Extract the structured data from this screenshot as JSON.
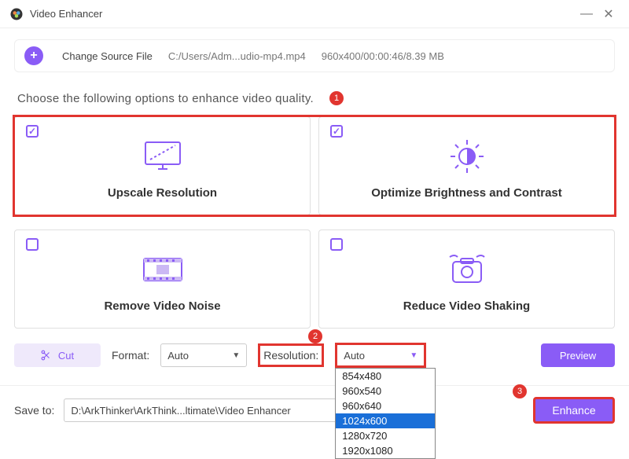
{
  "window": {
    "title": "Video Enhancer"
  },
  "header": {
    "change_label": "Change Source File",
    "file_path": "C:/Users/Adm...udio-mp4.mp4",
    "file_meta": "960x400/00:00:46/8.39 MB"
  },
  "instruction": "Choose the following options to enhance video quality.",
  "steps": {
    "s1": "1",
    "s2": "2",
    "s3": "3"
  },
  "options": {
    "upscale": {
      "label": "Upscale Resolution",
      "checked": true
    },
    "brightness": {
      "label": "Optimize Brightness and Contrast",
      "checked": true
    },
    "noise": {
      "label": "Remove Video Noise",
      "checked": false
    },
    "shaking": {
      "label": "Reduce Video Shaking",
      "checked": false
    }
  },
  "toolbar": {
    "cut_label": "Cut",
    "format_label": "Format:",
    "format_value": "Auto",
    "resolution_label": "Resolution:",
    "resolution_value": "Auto",
    "resolution_options": [
      "854x480",
      "960x540",
      "960x640",
      "1024x600",
      "1280x720",
      "1920x1080"
    ],
    "resolution_selected": "1024x600",
    "preview_label": "Preview"
  },
  "save": {
    "label": "Save to:",
    "path": "D:\\ArkThinker\\ArkThink...ltimate\\Video Enhancer",
    "enhance_label": "Enhance"
  }
}
